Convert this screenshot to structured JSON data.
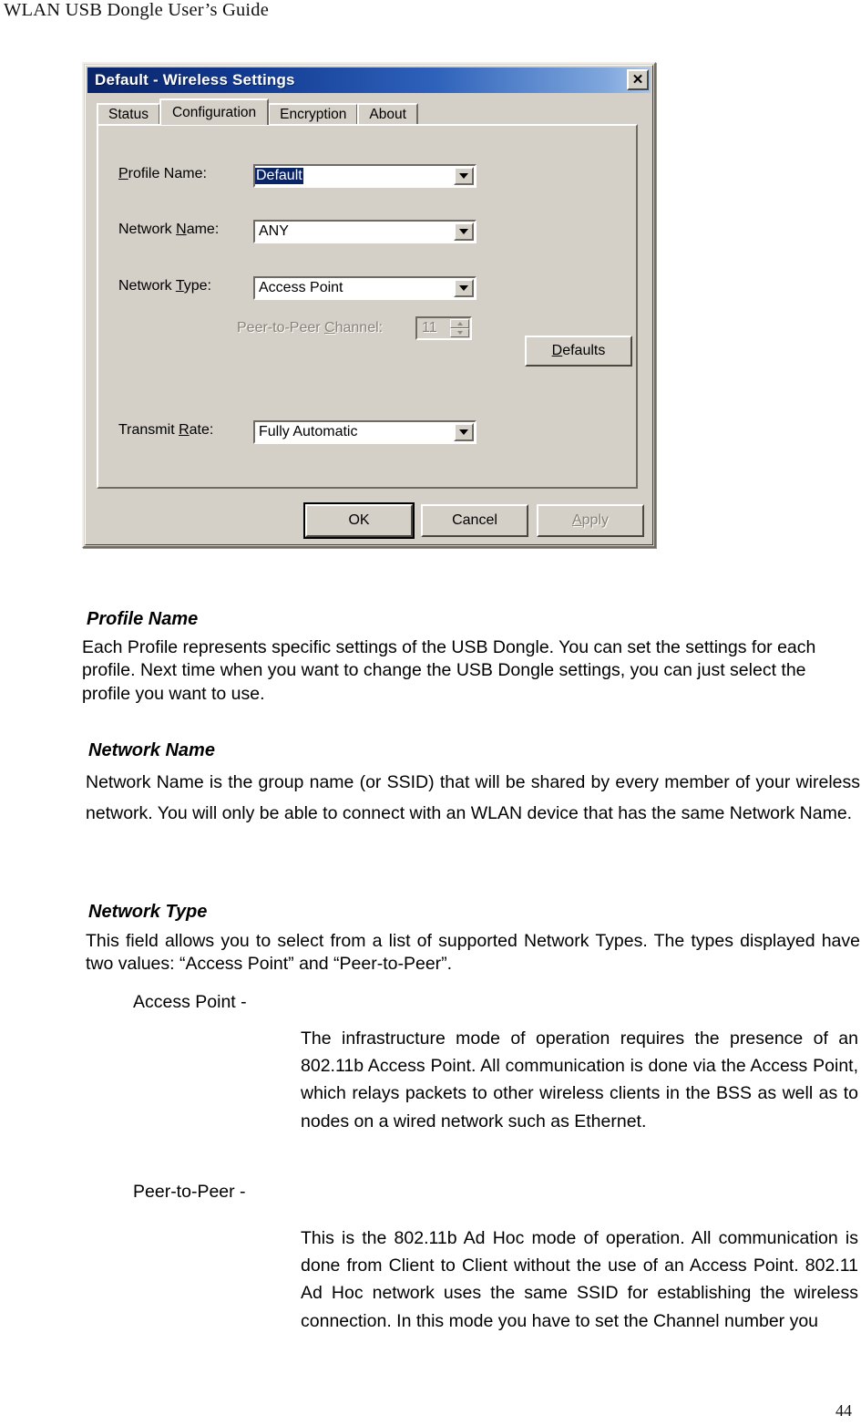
{
  "header": {
    "running_title": "WLAN USB Dongle User’s Guide",
    "page_number": "44"
  },
  "dialog": {
    "title": "Default - Wireless Settings",
    "close_icon": "close-icon",
    "tabs": [
      {
        "label": "Status",
        "selected": false
      },
      {
        "label": "Configuration",
        "selected": true
      },
      {
        "label": "Encryption",
        "selected": false
      },
      {
        "label": "About",
        "selected": false
      }
    ],
    "fields": {
      "profile_name": {
        "label_pre": "P",
        "label_key": "r",
        "label_post": "ofile Name:",
        "label_full": "Profile Name:",
        "value": "Default",
        "selected": true
      },
      "network_name": {
        "label_pre": "Network ",
        "label_key": "N",
        "label_post": "ame:",
        "label_full": "Network Name:",
        "value": "ANY"
      },
      "network_type": {
        "label_pre": "Network ",
        "label_key": "T",
        "label_post": "ype:",
        "label_full": "Network Type:",
        "value": "Access Point"
      },
      "peer_channel": {
        "label_pre": "Peer-to-Peer ",
        "label_key": "C",
        "label_post": "hannel:",
        "label_full": "Peer-to-Peer Channel:",
        "value": "11",
        "disabled": true
      },
      "transmit_rate": {
        "label_pre": "Transmit ",
        "label_key": "R",
        "label_post": "ate:",
        "label_full": "Transmit Rate:",
        "value": "Fully Automatic"
      }
    },
    "buttons": {
      "defaults": {
        "label_pre": "",
        "label_key": "D",
        "label_post": "efaults",
        "label_full": "Defaults",
        "disabled": false
      },
      "ok": {
        "label": "OK",
        "default": true,
        "disabled": false
      },
      "cancel": {
        "label": "Cancel",
        "disabled": false
      },
      "apply": {
        "label_key": "A",
        "label_post": "pply",
        "label_full": "Apply",
        "disabled": true
      }
    }
  },
  "content": {
    "profile_name": {
      "heading": "Profile Name",
      "body": "Each Profile represents specific settings of the USB Dongle. You can set the settings for each profile. Next time when you want to change the USB Dongle settings, you can just select the profile you want to use."
    },
    "network_name": {
      "heading": "Network Name",
      "body": "Network Name is the group name (or SSID) that will be shared by every member of your wireless network. You will only be able to connect with an WLAN device that has the same Network Name."
    },
    "network_type": {
      "heading": "Network Type",
      "body": "This field allows you to select from a list of supported Network Types. The types displayed have two values: “Access Point” and “Peer-to-Peer”.",
      "items": [
        {
          "term": "Access Point -",
          "definition": "The infrastructure mode of operation requires the presence of an 802.11b Access Point. All communication is done via the Access Point, which relays packets to other wireless clients in the BSS as well as to nodes on a wired network such as Ethernet."
        },
        {
          "term": "Peer-to-Peer -",
          "definition": "This is the 802.11b Ad Hoc mode of operation. All communication is done from Client to Client without the use of an Access Point. 802.11 Ad Hoc network uses the same SSID for establishing the wireless connection. In this mode you have to set the Channel number you"
        }
      ]
    }
  }
}
